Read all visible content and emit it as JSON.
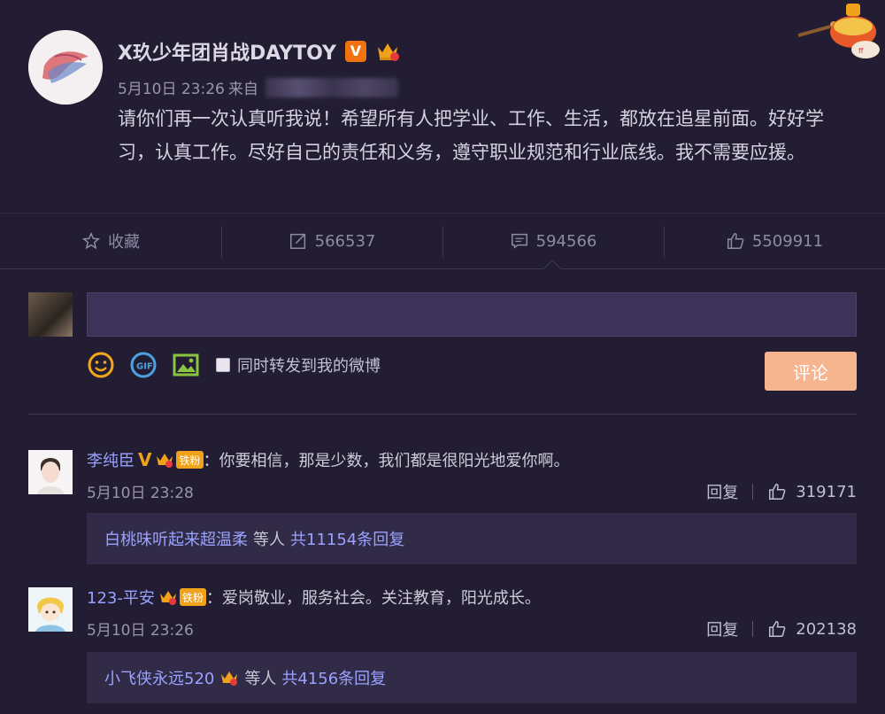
{
  "post": {
    "author": "X玖少年团肖战DAYTOY",
    "time": "5月10日 23:26",
    "source_prefix": "来自",
    "content": "请你们再一次认真听我说！希望所有人把学业、工作、生活，都放在追星前面。好好学习，认真工作。尽好自己的责任和义务，遵守职业规范和行业底线。我不需要应援。",
    "verified_badge": "V"
  },
  "actions": {
    "favorite": "收藏",
    "repost_count": "566537",
    "comment_count": "594566",
    "like_count": "5509911"
  },
  "composer": {
    "input_value": "",
    "forward_label": "同时转发到我的微博",
    "submit_label": "评论",
    "gif_label": "GIF"
  },
  "comments": [
    {
      "name": "李纯臣",
      "verified": "V",
      "fan_label": "铁粉",
      "text": "：你要相信，那是少数，我们都是很阳光地爱你啊。",
      "time": "5月10日 23:28",
      "reply_label": "回复",
      "likes": "319171",
      "reply_user": "白桃味听起来超温柔",
      "reply_suffix": "等人",
      "reply_total": "共11154条回复"
    },
    {
      "name": "123-平安",
      "fan_label": "铁粉",
      "text": "：爱岗敬业，服务社会。关注教育，阳光成长。",
      "time": "5月10日 23:26",
      "reply_label": "回复",
      "likes": "202138",
      "reply_user": "小飞侠永远520",
      "reply_suffix": "等人",
      "reply_total": "共4156条回复"
    }
  ],
  "colors": {
    "background": "#221d33",
    "accent_name": "#9aa2ff",
    "submit": "#f7b58f",
    "vip_orange": "#f0730f"
  }
}
